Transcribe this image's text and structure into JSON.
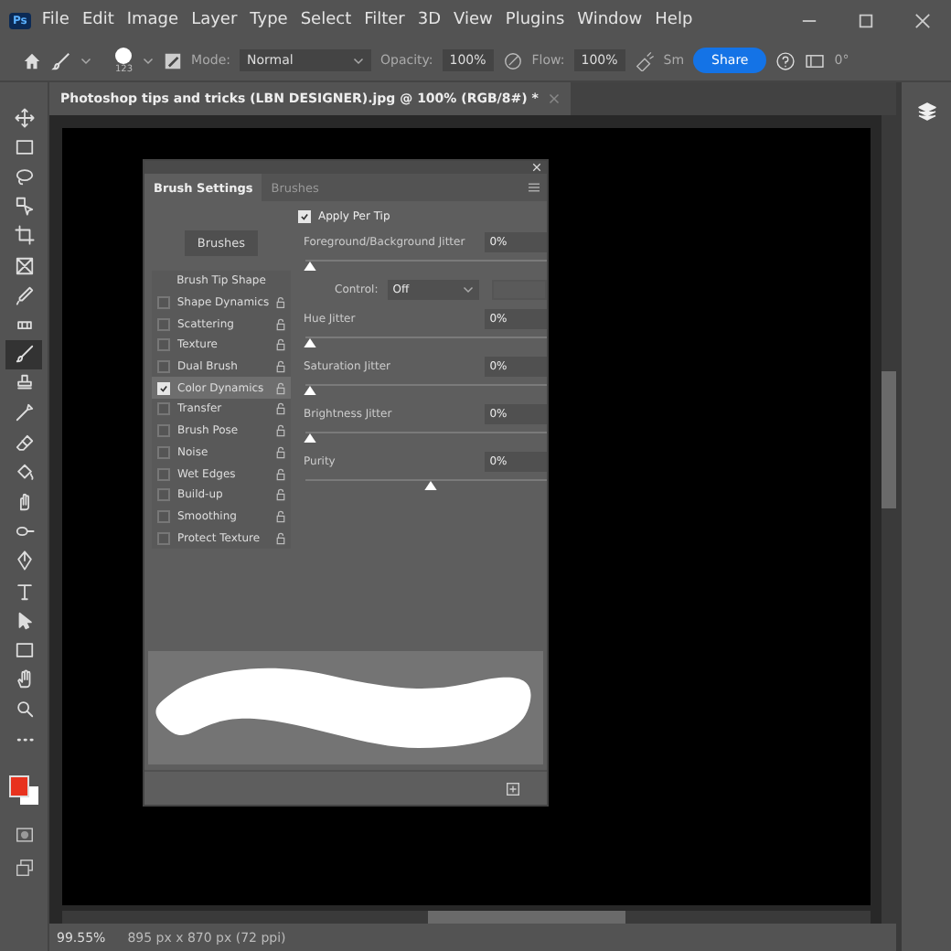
{
  "app_icon": "Ps",
  "menu": [
    "File",
    "Edit",
    "Image",
    "Layer",
    "Type",
    "Select",
    "Filter",
    "3D",
    "View",
    "Plugins",
    "Window",
    "Help"
  ],
  "options_bar": {
    "brush_size": "123",
    "mode_label": "Mode:",
    "mode": "Normal",
    "opacity_label": "Opacity:",
    "opacity": "100%",
    "flow_label": "Flow:",
    "flow": "100%",
    "smoothing_label": "Sm",
    "share": "Share",
    "angle": "0°"
  },
  "document_tab": {
    "title": "Photoshop tips and tricks (LBN DESIGNER).jpg @ 100% (RGB/8#) *"
  },
  "tools": [
    {
      "kind": "move",
      "selected": false
    },
    {
      "kind": "marquee",
      "selected": false
    },
    {
      "kind": "lasso",
      "selected": false
    },
    {
      "kind": "object-select",
      "selected": false
    },
    {
      "kind": "crop",
      "selected": false
    },
    {
      "kind": "frame",
      "selected": false
    },
    {
      "kind": "eyedropper",
      "selected": false
    },
    {
      "kind": "healing",
      "selected": false
    },
    {
      "kind": "brush",
      "selected": true
    },
    {
      "kind": "stamp",
      "selected": false
    },
    {
      "kind": "history",
      "selected": false
    },
    {
      "kind": "eraser",
      "selected": false
    },
    {
      "kind": "bucket",
      "selected": false
    },
    {
      "kind": "smudge",
      "selected": false
    },
    {
      "kind": "dodge",
      "selected": false
    },
    {
      "kind": "pen",
      "selected": false
    },
    {
      "kind": "type",
      "selected": false
    },
    {
      "kind": "path-select",
      "selected": false
    },
    {
      "kind": "rectangle",
      "selected": false
    },
    {
      "kind": "hand",
      "selected": false
    },
    {
      "kind": "zoom",
      "selected": false
    },
    {
      "kind": "more",
      "selected": false
    }
  ],
  "colors": {
    "foreground": {
      "color": "#e8321e"
    },
    "background": {
      "color": "#ffffff"
    }
  },
  "brush_panel": {
    "tabs": [
      {
        "label": "Brush Settings",
        "selected": true
      },
      {
        "label": "Brushes",
        "selected": false
      }
    ],
    "brushes_button": "Brushes",
    "heading": "Brush Tip Shape",
    "options": [
      {
        "label": "Shape Dynamics",
        "checked": false,
        "selected": false
      },
      {
        "label": "Scattering",
        "checked": false,
        "selected": false
      },
      {
        "label": "Texture",
        "checked": false,
        "selected": false
      },
      {
        "label": "Dual Brush",
        "checked": false,
        "selected": false
      },
      {
        "label": "Color Dynamics",
        "checked": true,
        "selected": true
      },
      {
        "label": "Transfer",
        "checked": false,
        "selected": false
      },
      {
        "label": "Brush Pose",
        "checked": false,
        "selected": false
      },
      {
        "label": "Noise",
        "checked": false,
        "selected": false
      },
      {
        "label": "Wet Edges",
        "checked": false,
        "selected": false
      },
      {
        "label": "Build-up",
        "checked": false,
        "selected": false
      },
      {
        "label": "Smoothing",
        "checked": false,
        "selected": false
      },
      {
        "label": "Protect Texture",
        "checked": false,
        "selected": false
      }
    ],
    "apply_per_tip": {
      "label": "Apply Per Tip",
      "checked": true
    },
    "settings": [
      {
        "kind": "slider",
        "label": "Foreground/Background Jitter",
        "value": "0%",
        "level": 0
      },
      {
        "kind": "control",
        "label": "Control:",
        "value": "Off"
      },
      {
        "kind": "slider",
        "label": "Hue Jitter",
        "value": "0%",
        "level": 0
      },
      {
        "kind": "slider",
        "label": "Saturation Jitter",
        "value": "0%",
        "level": 0
      },
      {
        "kind": "slider",
        "label": "Brightness Jitter",
        "value": "0%",
        "level": 0
      },
      {
        "kind": "slider",
        "label": "Purity",
        "value": "0%",
        "level": 0.5
      }
    ]
  },
  "status_bar": {
    "zoom": "99.55%",
    "info": "895 px x 870 px (72 ppi)"
  }
}
